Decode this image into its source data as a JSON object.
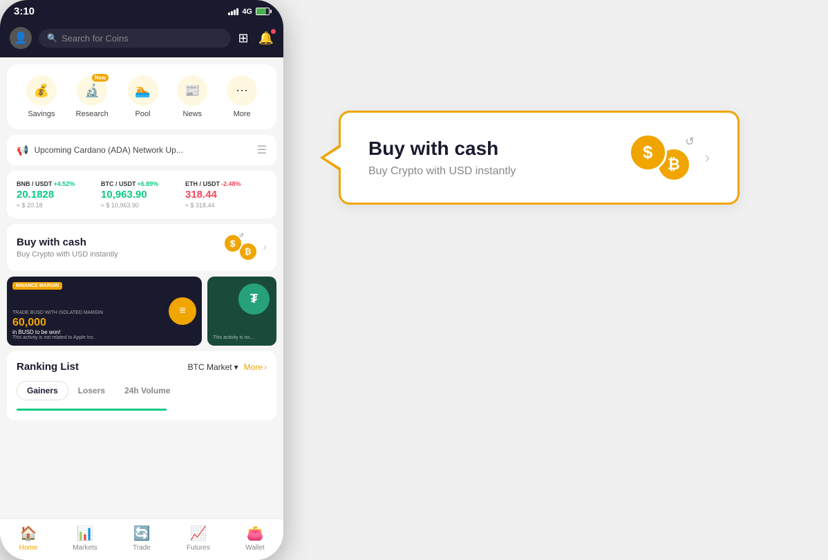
{
  "status_bar": {
    "time": "3:10",
    "network": "4G"
  },
  "top_nav": {
    "search_placeholder": "Search for Coins"
  },
  "quick_actions": {
    "items": [
      {
        "id": "savings",
        "label": "Savings",
        "icon": "💰",
        "new_badge": false
      },
      {
        "id": "research",
        "label": "Research",
        "icon": "🔬",
        "new_badge": true
      },
      {
        "id": "pool",
        "label": "Pool",
        "icon": "🏊",
        "new_badge": false
      },
      {
        "id": "news",
        "label": "News",
        "icon": "📰",
        "new_badge": false
      },
      {
        "id": "more",
        "label": "More",
        "icon": "⋯",
        "new_badge": false
      }
    ]
  },
  "announcement": {
    "text": "Upcoming Cardano (ADA) Network Up..."
  },
  "tickers": [
    {
      "pair": "BNB / USDT",
      "change": "+4.52%",
      "positive": true,
      "price": "20.1828",
      "usd": "≈ $ 20.18"
    },
    {
      "pair": "BTC / USDT",
      "change": "+6.89%",
      "positive": true,
      "price": "10,963.90",
      "usd": "≈ $ 10,963.90"
    },
    {
      "pair": "ETH / USDT",
      "change": "-2.48%",
      "positive": false,
      "price": "318.44",
      "usd": "≈ $ 318.44"
    }
  ],
  "buy_cash": {
    "title": "Buy with cash",
    "subtitle": "Buy Crypto with USD instantly"
  },
  "promo": {
    "banner1_label": "BINANCE MARGIN",
    "banner1_trade": "TRADE BUSD WITH ISOLATED MARGIN",
    "banner1_amount": "60,000",
    "banner1_sub": "in BUSD to be won!",
    "banner1_disclaimer": "This activity is not related to Apple Inc.",
    "banner2_disclaimer": "This activity is no..."
  },
  "ranking": {
    "title": "Ranking List",
    "market": "BTC Market",
    "more_label": "More",
    "tabs": [
      "Gainers",
      "Losers",
      "24h Volume"
    ],
    "active_tab": 0
  },
  "bottom_nav": {
    "items": [
      {
        "id": "home",
        "label": "Home",
        "icon": "🏠",
        "active": true
      },
      {
        "id": "markets",
        "label": "Markets",
        "icon": "📊",
        "active": false
      },
      {
        "id": "trade",
        "label": "Trade",
        "icon": "🔄",
        "active": false
      },
      {
        "id": "futures",
        "label": "Futures",
        "icon": "📈",
        "active": false
      },
      {
        "id": "wallet",
        "label": "Wallet",
        "icon": "👛",
        "active": false
      }
    ]
  },
  "callout": {
    "title": "Buy with cash",
    "subtitle": "Buy Crypto with USD instantly"
  }
}
